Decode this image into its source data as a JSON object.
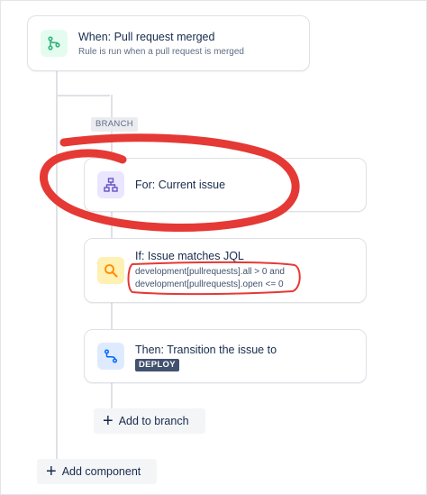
{
  "trigger": {
    "title": "When: Pull request merged",
    "subtitle": "Rule is run when a pull request is merged",
    "icon": "git-merge-icon"
  },
  "branch": {
    "tag": "BRANCH",
    "for_title": "For: Current issue",
    "icon": "hierarchy-icon"
  },
  "condition": {
    "title": "If: Issue matches JQL",
    "jql_line1": "development[pullrequests].all > 0 and",
    "jql_line2": "development[pullrequests].open <= 0",
    "icon": "search-icon"
  },
  "action": {
    "title": "Then: Transition the issue to",
    "badge": "DEPLOY",
    "icon": "transition-icon"
  },
  "buttons": {
    "add_to_branch": "Add to branch",
    "add_component": "Add component"
  },
  "colors": {
    "trigger_icon_bg": "#e3fcef",
    "trigger_icon": "#36b37e",
    "branch_icon_bg": "#eae6ff",
    "branch_icon": "#6554c0",
    "condition_icon_bg": "#fff0b3",
    "condition_icon": "#ff8b00",
    "action_icon_bg": "#deebff",
    "action_icon": "#0065ff",
    "annotation": "#e53935"
  }
}
